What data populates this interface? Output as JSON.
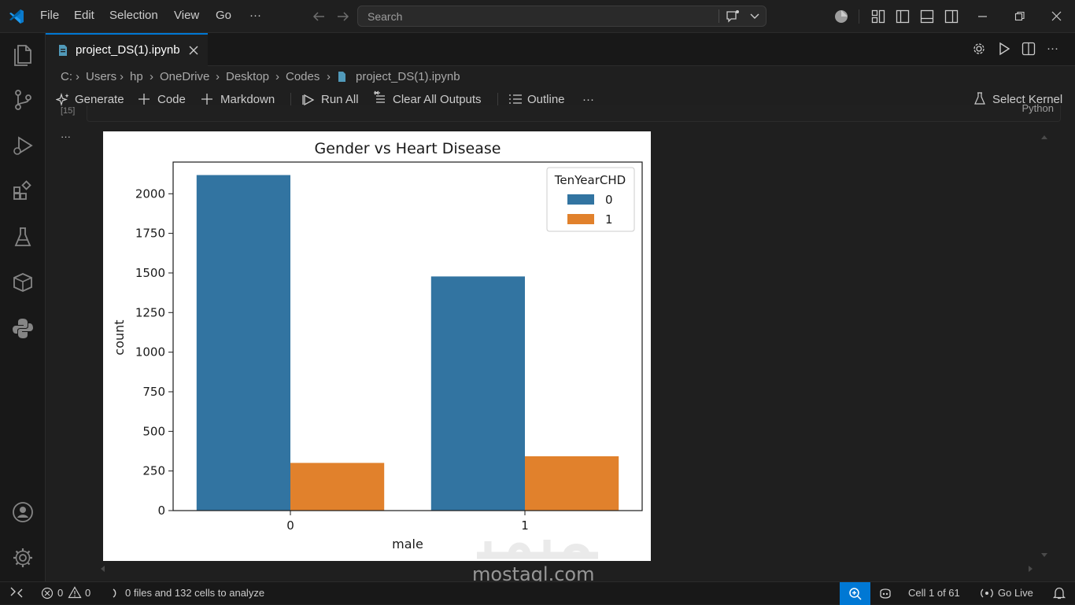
{
  "menu": {
    "file": "File",
    "edit": "Edit",
    "selection": "Selection",
    "view": "View",
    "go": "Go",
    "more": "···"
  },
  "search": {
    "placeholder": "Search"
  },
  "tab": {
    "label": "project_DS(1).ipynb"
  },
  "breadcrumb": [
    "C:",
    "Users",
    "hp",
    "OneDrive",
    "Desktop",
    "Codes",
    "project_DS(1).ipynb"
  ],
  "toolbar": {
    "generate": "Generate",
    "code": "Code",
    "markdown": "Markdown",
    "run_all": "Run All",
    "clear_outputs": "Clear All Outputs",
    "outline": "Outline",
    "more": "···",
    "select_kernel": "Select Kernel"
  },
  "cell": {
    "exec_count": "[15]",
    "language": "Python",
    "output_more": "···"
  },
  "status": {
    "errors": "0",
    "warnings": "0",
    "analyze": "0 files and 132 cells to analyze",
    "cell_pos": "Cell 1 of 61",
    "go_live": "Go Live"
  },
  "watermark": {
    "brand": "mostaql.com"
  },
  "colors": {
    "accent": "#0078d4",
    "series0": "#3274a1",
    "series1": "#e1812c"
  },
  "chart_data": {
    "type": "bar",
    "title": "Gender vs Heart Disease",
    "xlabel": "male",
    "ylabel": "count",
    "categories": [
      "0",
      "1"
    ],
    "legend_title": "TenYearCHD",
    "legend_position": "top-right",
    "ylim": [
      0,
      2200
    ],
    "yticks": [
      0,
      250,
      500,
      750,
      1000,
      1250,
      1500,
      1750,
      2000
    ],
    "series": [
      {
        "name": "0",
        "values": [
          2118,
          1478
        ],
        "color": "#3274a1"
      },
      {
        "name": "1",
        "values": [
          301,
          343
        ],
        "color": "#e1812c"
      }
    ]
  }
}
